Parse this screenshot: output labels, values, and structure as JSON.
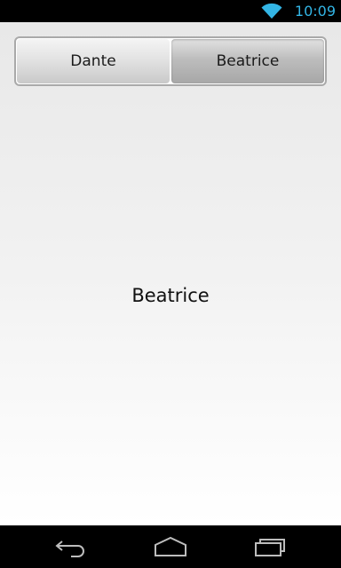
{
  "status_bar": {
    "time": "10:09",
    "wifi_icon": "wifi-icon",
    "accent_color": "#33b5e5"
  },
  "segmented_control": {
    "options": [
      {
        "label": "Dante",
        "selected": false
      },
      {
        "label": "Beatrice",
        "selected": true
      }
    ]
  },
  "content": {
    "selected_text": "Beatrice"
  },
  "nav_bar": {
    "back_icon": "back-icon",
    "home_icon": "home-icon",
    "recents_icon": "recents-icon"
  }
}
